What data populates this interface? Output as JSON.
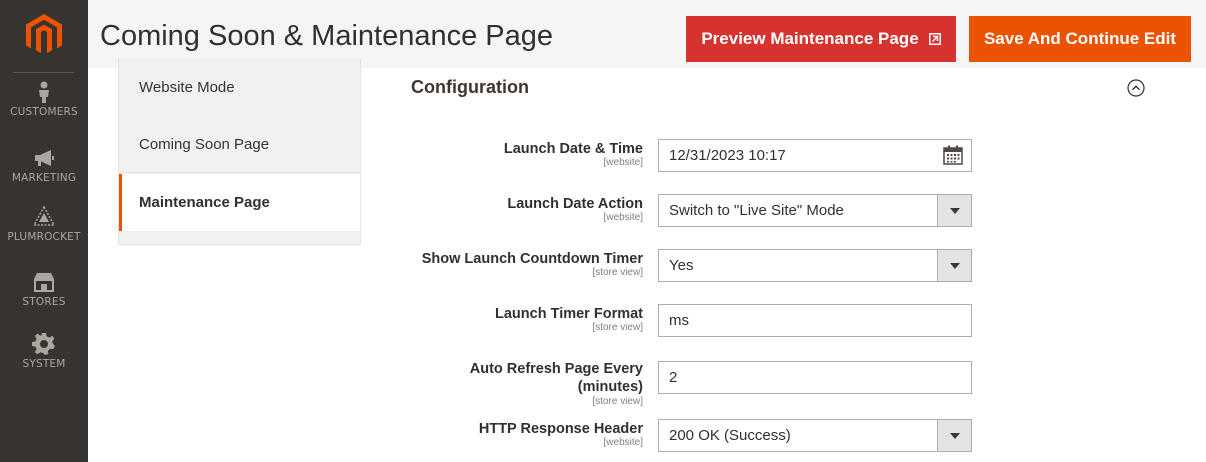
{
  "header": {
    "title": "Coming Soon & Maintenance Page",
    "preview_label": "Preview Maintenance Page",
    "save_label": "Save And Continue Edit"
  },
  "nav": {
    "items": [
      {
        "label": "CUSTOMERS",
        "icon": "customer-icon"
      },
      {
        "label": "MARKETING",
        "icon": "megaphone-icon"
      },
      {
        "label": "PLUMROCKET",
        "icon": "plumrocket-icon"
      },
      {
        "label": "STORES",
        "icon": "store-icon"
      },
      {
        "label": "SYSTEM",
        "icon": "gear-icon"
      }
    ]
  },
  "tabs": [
    {
      "label": "Website Mode"
    },
    {
      "label": "Coming Soon Page"
    },
    {
      "label": "Maintenance Page",
      "active": true
    }
  ],
  "config": {
    "title": "Configuration",
    "fields": [
      {
        "label": "Launch Date & Time",
        "scope": "[website]",
        "value": "12/31/2023 10:17",
        "type": "date"
      },
      {
        "label": "Launch Date Action",
        "scope": "[website]",
        "value": "Switch to \"Live Site\" Mode",
        "type": "select"
      },
      {
        "label": "Show Launch Countdown Timer",
        "scope": "[store view]",
        "value": "Yes",
        "type": "select"
      },
      {
        "label": "Launch Timer Format",
        "scope": "[store view]",
        "value": "ms",
        "type": "text"
      },
      {
        "label_line1": "Auto Refresh Page Every",
        "label_line2": "(minutes)",
        "scope": "[store view]",
        "value": "2",
        "type": "text"
      },
      {
        "label": "HTTP Response Header",
        "scope": "[website]",
        "value": "200 OK (Success)",
        "type": "select"
      }
    ]
  },
  "colors": {
    "nav_bg": "#373330",
    "accent_orange": "#eb5202",
    "preview_red": "#d6322e"
  }
}
